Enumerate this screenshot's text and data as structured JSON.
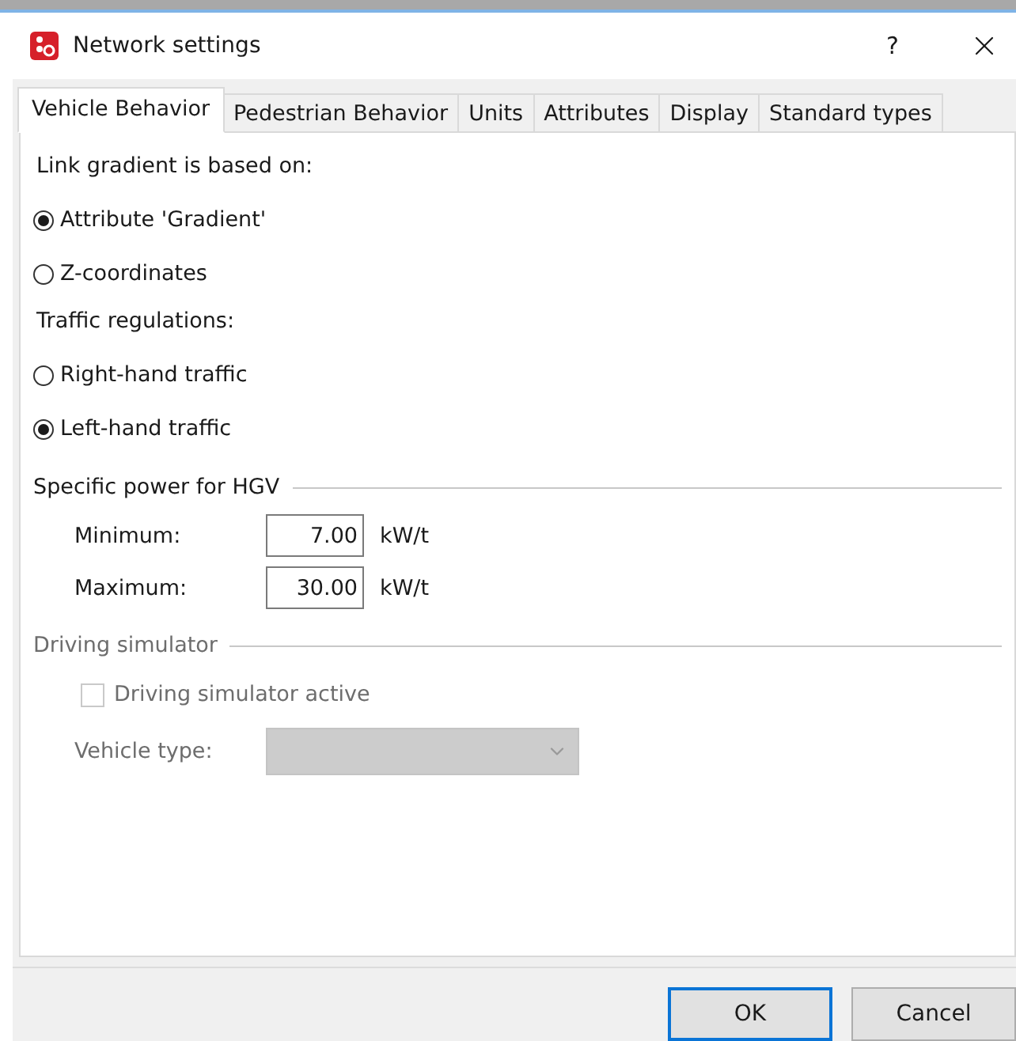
{
  "window": {
    "title": "Network settings",
    "help": "?"
  },
  "tabs": [
    {
      "label": "Vehicle Behavior",
      "selected": true
    },
    {
      "label": "Pedestrian Behavior",
      "selected": false
    },
    {
      "label": "Units",
      "selected": false
    },
    {
      "label": "Attributes",
      "selected": false
    },
    {
      "label": "Display",
      "selected": false
    },
    {
      "label": "Standard types",
      "selected": false
    }
  ],
  "radio_groups": [
    {
      "label": "Link gradient is based on:",
      "options": [
        {
          "label": "Attribute 'Gradient'",
          "selected": true
        },
        {
          "label": "Z-coordinates",
          "selected": false
        }
      ]
    },
    {
      "label": "Traffic regulations:",
      "options": [
        {
          "label": "Right-hand traffic",
          "selected": false
        },
        {
          "label": "Left-hand traffic",
          "selected": true
        }
      ]
    }
  ],
  "hgv_power": {
    "title": "Specific power for HGV",
    "fields": [
      {
        "label": "Minimum:",
        "value": "7.00",
        "unit": "kW/t"
      },
      {
        "label": "Maximum:",
        "value": "30.00",
        "unit": "kW/t"
      }
    ]
  },
  "driving_simulator": {
    "title": "Driving simulator",
    "disabled": true,
    "active": {
      "label": "Driving simulator active",
      "checked": false
    },
    "vehicle_type": {
      "label": "Vehicle type:"
    }
  },
  "buttons": [
    {
      "label": "OK",
      "default": true
    },
    {
      "label": "Cancel",
      "default": false
    }
  ]
}
